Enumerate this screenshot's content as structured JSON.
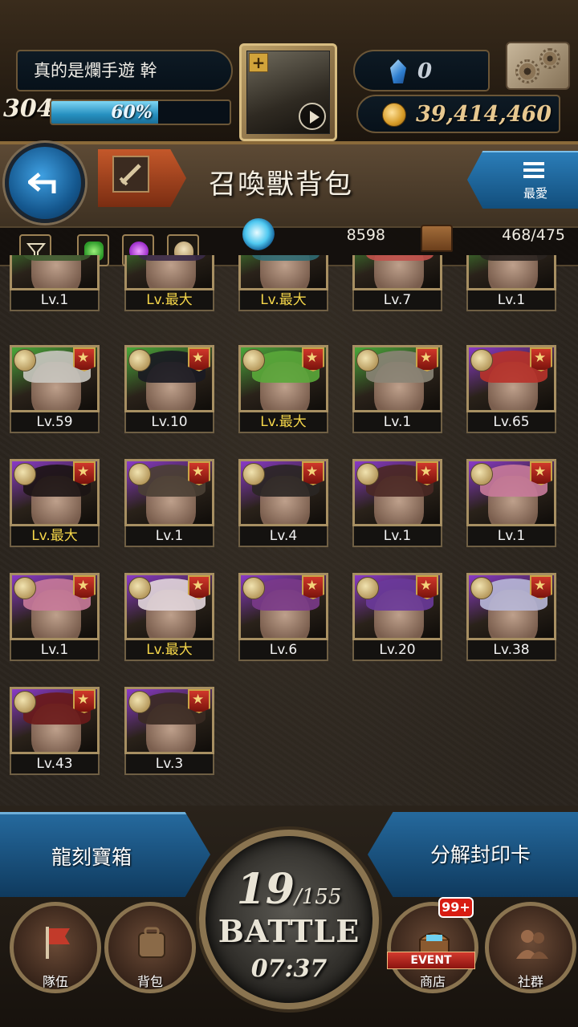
{
  "player": {
    "name": "真的是爛手遊 幹",
    "level": "304",
    "exp_percent": 60,
    "exp_text": "60%",
    "gems": "0",
    "gold": "39,414,460"
  },
  "header": {
    "title": "召喚獸背包",
    "favorite_label": "最愛"
  },
  "inventory": {
    "orb_count": "8598",
    "capacity": "468/475"
  },
  "filters": [
    {
      "icon": "funnel-icon"
    },
    {
      "icon": "green-element-icon"
    },
    {
      "icon": "purple-element-icon"
    },
    {
      "icon": "skull-icon"
    }
  ],
  "cards": [
    {
      "level": "Lv.1",
      "max": false,
      "frame": "green",
      "hair": "#3d5a2f"
    },
    {
      "level": "Lv.最大",
      "max": true,
      "frame": "green",
      "hair": "#3a2a48"
    },
    {
      "level": "Lv.最大",
      "max": true,
      "frame": "green",
      "hair": "#2f6a72"
    },
    {
      "level": "Lv.7",
      "max": false,
      "frame": "green",
      "hair": "#c0504a"
    },
    {
      "level": "Lv.1",
      "max": false,
      "frame": "green",
      "hair": "#2a2320"
    },
    {
      "level": "Lv.59",
      "max": false,
      "frame": "green",
      "hair": "#c9c6c0"
    },
    {
      "level": "Lv.10",
      "max": false,
      "frame": "green",
      "hair": "#1a1a22"
    },
    {
      "level": "Lv.最大",
      "max": true,
      "frame": "green",
      "hair": "#5aa83a"
    },
    {
      "level": "Lv.1",
      "max": false,
      "frame": "green",
      "hair": "#8a8476"
    },
    {
      "level": "Lv.65",
      "max": false,
      "frame": "purple",
      "hair": "#b8322a"
    },
    {
      "level": "Lv.最大",
      "max": true,
      "frame": "purple",
      "hair": "#1c1414"
    },
    {
      "level": "Lv.1",
      "max": false,
      "frame": "purple",
      "hair": "#4a3f34"
    },
    {
      "level": "Lv.4",
      "max": false,
      "frame": "purple",
      "hair": "#2a2624"
    },
    {
      "level": "Lv.1",
      "max": false,
      "frame": "purple",
      "hair": "#4a2824"
    },
    {
      "level": "Lv.1",
      "max": false,
      "frame": "purple",
      "hair": "#c87a9a"
    },
    {
      "level": "Lv.1",
      "max": false,
      "frame": "purple",
      "hair": "#c87a9a"
    },
    {
      "level": "Lv.最大",
      "max": true,
      "frame": "purple",
      "hair": "#e2d6dc"
    },
    {
      "level": "Lv.6",
      "max": false,
      "frame": "purple",
      "hair": "#7a3a8a"
    },
    {
      "level": "Lv.20",
      "max": false,
      "frame": "purple",
      "hair": "#6a3a9a"
    },
    {
      "level": "Lv.38",
      "max": false,
      "frame": "purple",
      "hair": "#b8b8d8"
    },
    {
      "level": "Lv.43",
      "max": false,
      "frame": "purple",
      "hair": "#6a1a1a"
    },
    {
      "level": "Lv.3",
      "max": false,
      "frame": "purple",
      "hair": "#3a2a22"
    }
  ],
  "actions": {
    "chest_label": "龍刻寶箱",
    "decompose_label": "分解封印卡"
  },
  "battle": {
    "stamina_current": "19",
    "stamina_max": "/155",
    "label": "BATTLE",
    "timer": "07:37"
  },
  "nav": {
    "team": "隊伍",
    "bag": "背包",
    "shop": "商店",
    "social": "社群",
    "event_tag": "EVENT",
    "notif_count": "99+"
  },
  "colors": {
    "max_level": "#f5d64a",
    "accent_blue": "#25699d",
    "frame_green": "#4aa83a",
    "frame_purple": "#8a3ac8"
  }
}
